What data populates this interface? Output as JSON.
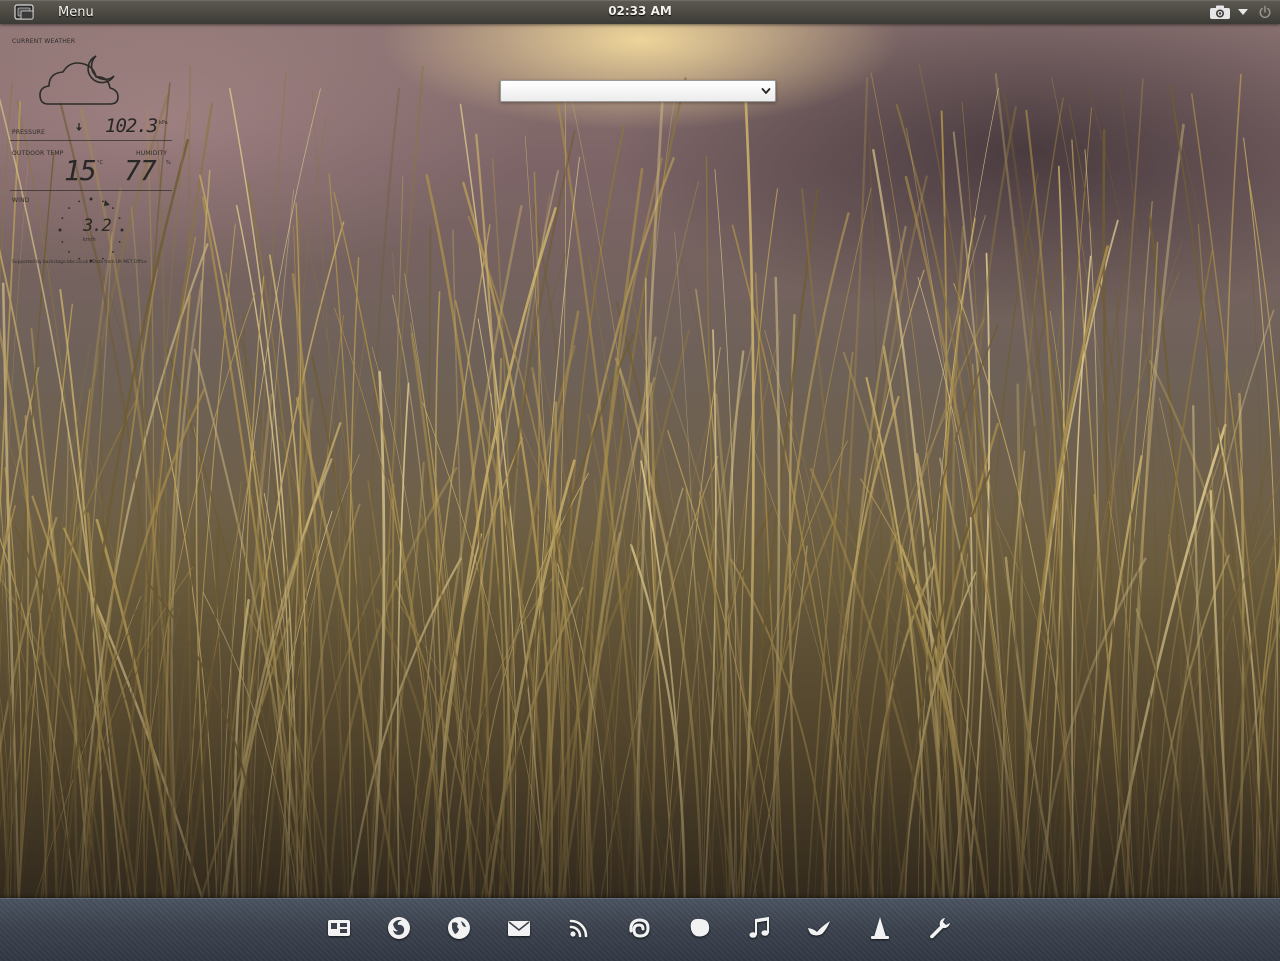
{
  "top_panel": {
    "menu_label": "Menu",
    "clock": "02:33 AM",
    "tray_icons": [
      "camera-icon",
      "dropdown-arrow-icon",
      "power-icon"
    ]
  },
  "address_combo": {
    "value": ""
  },
  "weather": {
    "title": "CURRENT WEATHER",
    "condition_icon": "cloud-moon-icon",
    "pressure_label": "PRESSURE",
    "pressure_value": "102.3",
    "pressure_unit": "kPa",
    "pressure_trend": "falling",
    "outdoor_temp_label": "OUTDOOR TEMP",
    "outdoor_temp_value": "15",
    "temp_unit": "°C",
    "humidity_label": "HUMIDITY",
    "humidity_value": "77",
    "humidity_unit": "%",
    "wind_label": "WIND",
    "wind_value": "3.2",
    "wind_unit": "km/h",
    "credits": "Supported by backstage.bbc.co.uk / Data from UK MET Office"
  },
  "dock": {
    "items": [
      {
        "name": "files-icon"
      },
      {
        "name": "firefox-icon"
      },
      {
        "name": "browser-globe-icon"
      },
      {
        "name": "mail-icon"
      },
      {
        "name": "rss-feed-icon"
      },
      {
        "name": "chat-spiral-icon"
      },
      {
        "name": "notes-icon"
      },
      {
        "name": "music-note-icon"
      },
      {
        "name": "bird-client-icon"
      },
      {
        "name": "vlc-cone-icon"
      },
      {
        "name": "settings-wrench-icon"
      }
    ]
  },
  "colors": {
    "panel": "#3d3b35",
    "dock": "#3a414d",
    "widget_text": "#2d2b29",
    "accent_grass": "#b59a52"
  }
}
